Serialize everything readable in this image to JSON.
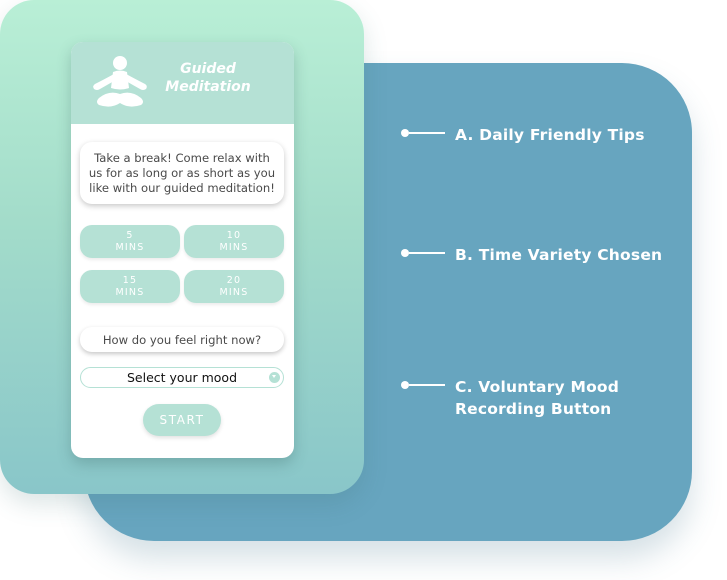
{
  "app": {
    "title_line1": "Guided",
    "title_line2": "Meditation",
    "icon": "meditation-figure-icon"
  },
  "tip": {
    "text": "Take a break! Come relax with us for as long or as short as you like with our guided meditation!"
  },
  "time_options": [
    {
      "value": "5",
      "unit": "MINS"
    },
    {
      "value": "10",
      "unit": "MINS"
    },
    {
      "value": "15",
      "unit": "MINS"
    },
    {
      "value": "20",
      "unit": "MINS"
    }
  ],
  "mood": {
    "question": "How do you feel right now?",
    "select_value": "Select your mood",
    "dropdown_icon": "chevron-down-icon"
  },
  "start_label": "START",
  "annotations": [
    {
      "label": "A. Daily Friendly Tips"
    },
    {
      "label": "B. Time Variety Chosen"
    },
    {
      "label": "C. Voluntary Mood\nRecording Button"
    }
  ],
  "colors": {
    "blue_panel": "#67a5bf",
    "mint_accent": "#b5e1d5",
    "green_card_top": "#b9efd6",
    "green_card_bottom": "#89c6c9"
  }
}
